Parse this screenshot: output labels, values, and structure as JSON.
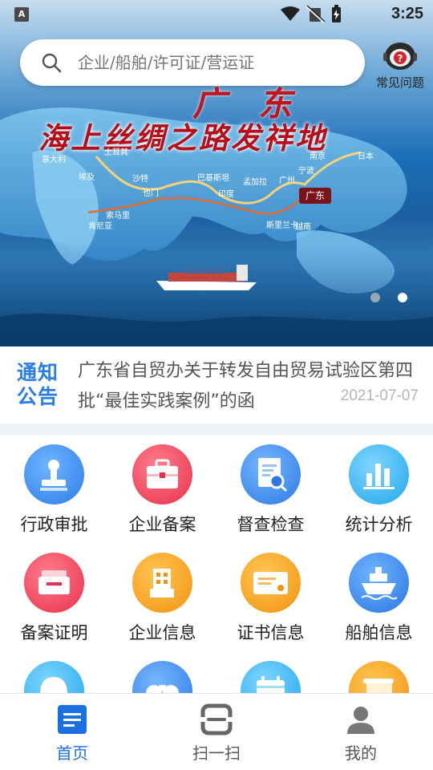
{
  "status_bar": {
    "time": "3:25",
    "app_badge": "A"
  },
  "search": {
    "placeholder": "企业/船舶/许可证/营运证"
  },
  "faq": {
    "label": "常见问题"
  },
  "banner": {
    "title": "海上丝绸之路发祥地",
    "title_top": "广东",
    "tag": "广东",
    "places": [
      "意大利",
      "土耳其",
      "埃及",
      "沙特",
      "也门",
      "巴基斯坦",
      "印度",
      "孟加拉",
      "广州",
      "宁波",
      "南京",
      "日本",
      "肯尼亚",
      "索马里",
      "越南",
      "斯里兰卡"
    ],
    "slide_count": 2,
    "active_slide": 2
  },
  "notice": {
    "badge_line1": "通知",
    "badge_line2": "公告",
    "text": "广东省自贸办关于转发自由贸易试验区第四批“最佳实践案例”的函",
    "date": "2021-07-07"
  },
  "grid": {
    "items": [
      {
        "label": "行政审批",
        "icon": "stamp-icon",
        "color": "#3b8cf0"
      },
      {
        "label": "企业备案",
        "icon": "briefcase-icon",
        "color": "#f0455e"
      },
      {
        "label": "督查检查",
        "icon": "document-search-icon",
        "color": "#3b8cf0"
      },
      {
        "label": "统计分析",
        "icon": "bar-chart-icon",
        "color": "#2fb4ef"
      },
      {
        "label": "备案证明",
        "icon": "tray-icon",
        "color": "#f0455e"
      },
      {
        "label": "企业信息",
        "icon": "building-icon",
        "color": "#f7a21b"
      },
      {
        "label": "证书信息",
        "icon": "certificate-icon",
        "color": "#f7a21b"
      },
      {
        "label": "船舶信息",
        "icon": "ship-icon",
        "color": "#3b8cf0"
      },
      {
        "label": "",
        "icon": "helmet-icon",
        "color": "#2fb4ef"
      },
      {
        "label": "",
        "icon": "binoculars-icon",
        "color": "#3b8cf0"
      },
      {
        "label": "",
        "icon": "calendar-icon",
        "color": "#2fb4ef"
      },
      {
        "label": "",
        "icon": "scroll-icon",
        "color": "#f7a21b"
      }
    ]
  },
  "tabs": [
    {
      "label": "首页",
      "icon": "home-doc-icon",
      "active": true
    },
    {
      "label": "扫一扫",
      "icon": "scan-icon",
      "active": false
    },
    {
      "label": "我的",
      "icon": "user-icon",
      "active": false
    }
  ],
  "colors": {
    "accent": "#1a6fe3",
    "tab_inactive": "#555555",
    "banner_title": "#b60f1a"
  }
}
